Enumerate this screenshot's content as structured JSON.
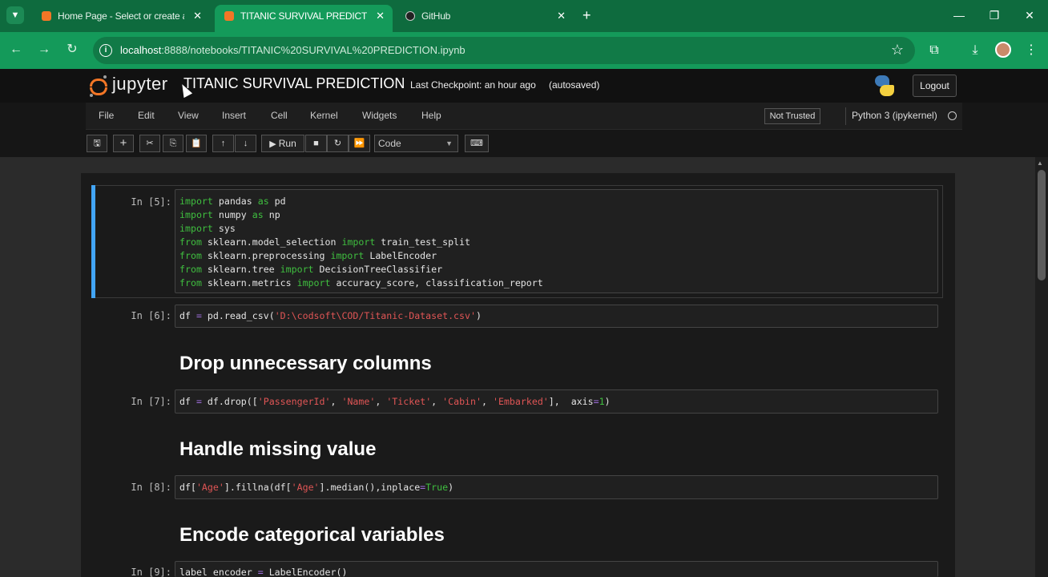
{
  "browser": {
    "tabs": [
      {
        "title": "Home Page - Select or create a",
        "active": false,
        "favicon_color": "#f37626"
      },
      {
        "title": "TITANIC SURVIVAL PREDICTION",
        "active": true,
        "favicon_color": "#f37626"
      },
      {
        "title": "GitHub",
        "active": false,
        "favicon_color": "#222222"
      }
    ],
    "tab_close_glyph": "✕",
    "new_tab_glyph": "+",
    "url_host": "localhost",
    "url_path": ":8888/notebooks/TITANIC%20SURVIVAL%20PREDICTION.ipynb",
    "accent_color": "#149a5a"
  },
  "jupyter": {
    "brand": "jupyter",
    "notebook_title": "TITANIC SURVIVAL PREDICTION",
    "checkpoint": "Last Checkpoint: an hour ago",
    "autosave_status": "(autosaved)",
    "logout_label": "Logout",
    "menu": [
      "File",
      "Edit",
      "View",
      "Insert",
      "Cell",
      "Kernel",
      "Widgets",
      "Help"
    ],
    "trust_status": "Not Trusted",
    "kernel_name": "Python 3 (ipykernel)",
    "run_label": "Run",
    "cell_type": "Code"
  },
  "cells": [
    {
      "prompt": "In [5]:",
      "type": "code"
    },
    {
      "prompt": "In [6]:",
      "type": "code"
    },
    {
      "type": "markdown",
      "text": "Drop unnecessary columns"
    },
    {
      "prompt": "In [7]:",
      "type": "code"
    },
    {
      "type": "markdown",
      "text": "Handle missing value"
    },
    {
      "prompt": "In [8]:",
      "type": "code"
    },
    {
      "type": "markdown",
      "text": "Encode categorical variables"
    },
    {
      "prompt": "In [9]:",
      "type": "code"
    }
  ],
  "code": {
    "c5": [
      [
        "import",
        " pandas ",
        "as",
        " pd"
      ],
      [
        "import",
        " numpy ",
        "as",
        " np"
      ],
      [
        "import",
        " sys",
        "",
        ""
      ],
      [
        "from",
        " sklearn.model_selection ",
        "import",
        " train_test_split"
      ],
      [
        "from",
        " sklearn.preprocessing ",
        "import",
        " LabelEncoder"
      ],
      [
        "from",
        " sklearn.tree ",
        "import",
        " DecisionTreeClassifier"
      ],
      [
        "from",
        " sklearn.metrics ",
        "import",
        " accuracy_score, classification_report"
      ]
    ],
    "c6_a": "df ",
    "c6_eq": "=",
    "c6_b": " pd.read_csv(",
    "c6_str": "'D:\\codsoft\\COD/Titanic-Dataset.csv'",
    "c6_c": ")",
    "c7_a": "df ",
    "c7_eq": "=",
    "c7_b": " df.drop([",
    "c7_s1": "'PassengerId'",
    "c7_s2": "'Name'",
    "c7_s3": "'Ticket'",
    "c7_s4": "'Cabin'",
    "c7_s5": "'Embarked'",
    "c7_comma": ", ",
    "c7_c": "],  axis",
    "c7_eq2": "=",
    "c7_num": "1",
    "c7_d": ")",
    "c8_a": "df[",
    "c8_s1": "'Age'",
    "c8_b": "].fillna(df[",
    "c8_s2": "'Age'",
    "c8_c": "].median(),inplace",
    "c8_eq": "=",
    "c8_true": "True",
    "c8_d": ")",
    "c9_a": "label_encoder ",
    "c9_eq": "=",
    "c9_b": " LabelEncoder()"
  }
}
